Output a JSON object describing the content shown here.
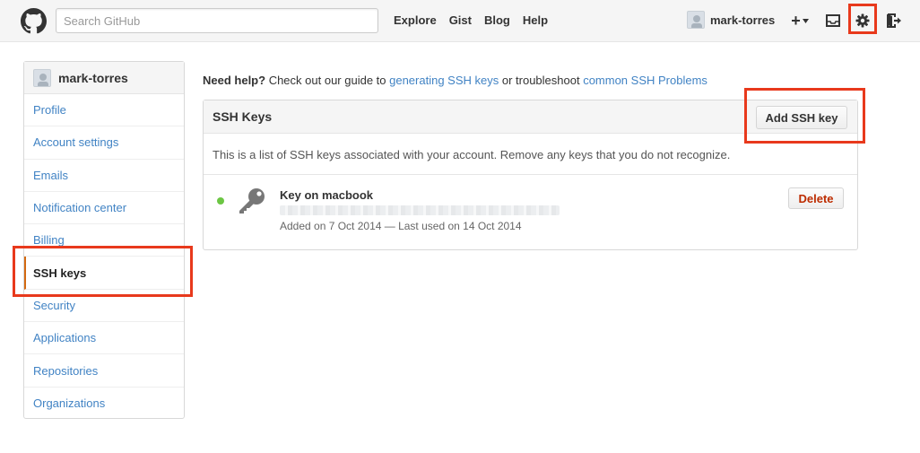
{
  "header": {
    "search_placeholder": "Search GitHub",
    "nav": [
      "Explore",
      "Gist",
      "Blog",
      "Help"
    ],
    "username": "mark-torres",
    "plus_label": "+",
    "icons": [
      "github-octocat-icon",
      "plus-icon",
      "inbox-icon",
      "gear-icon",
      "sign-out-icon"
    ]
  },
  "sidebar": {
    "username": "mark-torres",
    "items": [
      {
        "label": "Profile"
      },
      {
        "label": "Account settings"
      },
      {
        "label": "Emails"
      },
      {
        "label": "Notification center"
      },
      {
        "label": "Billing"
      },
      {
        "label": "SSH keys",
        "active": true
      },
      {
        "label": "Security"
      },
      {
        "label": "Applications"
      },
      {
        "label": "Repositories"
      },
      {
        "label": "Organizations"
      }
    ]
  },
  "help": {
    "lead": "Need help?",
    "text1": " Check out our guide to ",
    "link1": "generating SSH keys",
    "text2": " or troubleshoot ",
    "link2": "common SSH Problems"
  },
  "panel": {
    "title": "SSH Keys",
    "add_button": "Add SSH key",
    "description": "This is a list of SSH keys associated with your account. Remove any keys that you do not recognize.",
    "key": {
      "title": "Key on macbook",
      "meta": "Added on 7 Oct 2014 — Last used on 14 Oct 2014",
      "delete_button": "Delete",
      "status_color": "#6cc644"
    }
  },
  "colors": {
    "link": "#4183c4",
    "highlight": "#e8391c",
    "active_marker": "#d26911",
    "danger": "#bd2c00"
  }
}
